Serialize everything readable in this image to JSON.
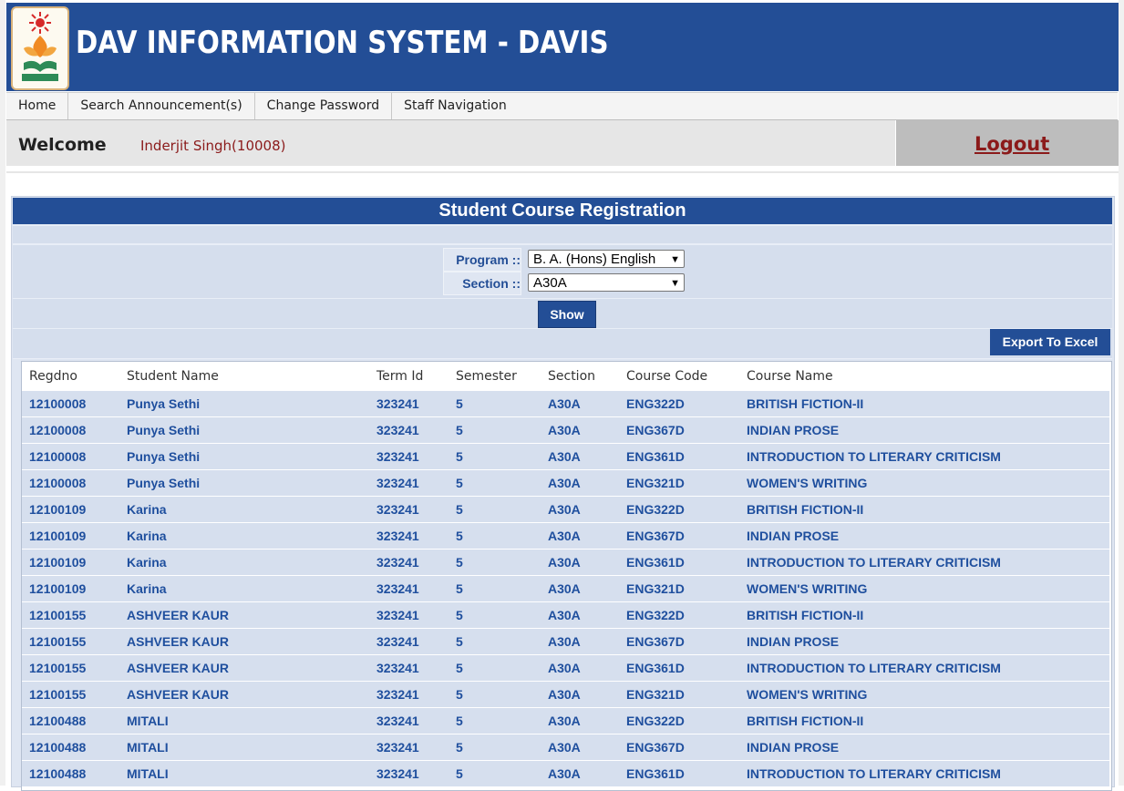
{
  "header": {
    "title": "DAV INFORMATION SYSTEM - DAVIS"
  },
  "nav": {
    "items": [
      "Home",
      "Search Announcement(s)",
      "Change Password",
      "Staff Navigation"
    ]
  },
  "welcome": {
    "label": "Welcome",
    "user": "Inderjit Singh(10008)",
    "logout": "Logout"
  },
  "panel": {
    "title": "Student Course Registration",
    "program_label": "Program ::",
    "program_value": "B. A. (Hons) English",
    "section_label": "Section ::",
    "section_value": "A30A",
    "show_label": "Show",
    "export_label": "Export To Excel"
  },
  "table": {
    "columns": [
      "Regdno",
      "Student Name",
      "Term Id",
      "Semester",
      "Section",
      "Course Code",
      "Course Name"
    ],
    "rows": [
      [
        "12100008",
        "Punya Sethi",
        "323241",
        "5",
        "A30A",
        "ENG322D",
        "BRITISH FICTION-II"
      ],
      [
        "12100008",
        "Punya Sethi",
        "323241",
        "5",
        "A30A",
        "ENG367D",
        "INDIAN PROSE"
      ],
      [
        "12100008",
        "Punya Sethi",
        "323241",
        "5",
        "A30A",
        "ENG361D",
        "INTRODUCTION TO LITERARY CRITICISM"
      ],
      [
        "12100008",
        "Punya Sethi",
        "323241",
        "5",
        "A30A",
        "ENG321D",
        "WOMEN'S WRITING"
      ],
      [
        "12100109",
        "Karina",
        "323241",
        "5",
        "A30A",
        "ENG322D",
        "BRITISH FICTION-II"
      ],
      [
        "12100109",
        "Karina",
        "323241",
        "5",
        "A30A",
        "ENG367D",
        "INDIAN PROSE"
      ],
      [
        "12100109",
        "Karina",
        "323241",
        "5",
        "A30A",
        "ENG361D",
        "INTRODUCTION TO LITERARY CRITICISM"
      ],
      [
        "12100109",
        "Karina",
        "323241",
        "5",
        "A30A",
        "ENG321D",
        "WOMEN'S WRITING"
      ],
      [
        "12100155",
        "ASHVEER KAUR",
        "323241",
        "5",
        "A30A",
        "ENG322D",
        "BRITISH FICTION-II"
      ],
      [
        "12100155",
        "ASHVEER KAUR",
        "323241",
        "5",
        "A30A",
        "ENG367D",
        "INDIAN PROSE"
      ],
      [
        "12100155",
        "ASHVEER KAUR",
        "323241",
        "5",
        "A30A",
        "ENG361D",
        "INTRODUCTION TO LITERARY CRITICISM"
      ],
      [
        "12100155",
        "ASHVEER KAUR",
        "323241",
        "5",
        "A30A",
        "ENG321D",
        "WOMEN'S WRITING"
      ],
      [
        "12100488",
        "MITALI",
        "323241",
        "5",
        "A30A",
        "ENG322D",
        "BRITISH FICTION-II"
      ],
      [
        "12100488",
        "MITALI",
        "323241",
        "5",
        "A30A",
        "ENG367D",
        "INDIAN PROSE"
      ],
      [
        "12100488",
        "MITALI",
        "323241",
        "5",
        "A30A",
        "ENG361D",
        "INTRODUCTION TO LITERARY CRITICISM"
      ]
    ]
  },
  "colors": {
    "brand_blue": "#234e96",
    "link_blue": "#1f4f9e",
    "user_red": "#8b1a1a",
    "row_bg": "#d6dfee"
  }
}
